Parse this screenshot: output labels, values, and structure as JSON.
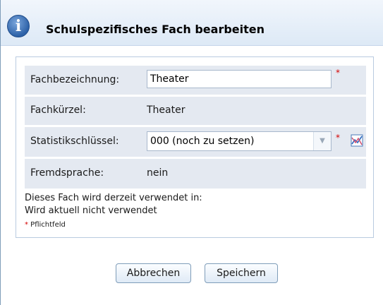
{
  "dialog": {
    "title": "Schulspezifisches Fach bearbeiten",
    "info_icon": "info-icon"
  },
  "form": {
    "fachbezeichnung": {
      "label": "Fachbezeichnung:",
      "value": "Theater",
      "required_mark": "*"
    },
    "fachkuerzel": {
      "label": "Fachkürzel:",
      "value": "Theater"
    },
    "statistikschluessel": {
      "label": "Statistikschlüssel:",
      "value": "000 (noch zu setzen)",
      "required_mark": "*",
      "icon": "chart-icon"
    },
    "fremdsprache": {
      "label": "Fremdsprache:",
      "value": "nein"
    }
  },
  "usage": {
    "line1": "Dieses Fach wird derzeit verwendet in:",
    "line2": "Wird aktuell nicht verwendet"
  },
  "required_note": {
    "star": "*",
    "text": " Pflichtfeld"
  },
  "buttons": {
    "cancel": "Abbrechen",
    "save": "Speichern"
  },
  "colors": {
    "required": "#d40000",
    "row_background": "#e4e9f1",
    "border": "#7f9db9"
  }
}
